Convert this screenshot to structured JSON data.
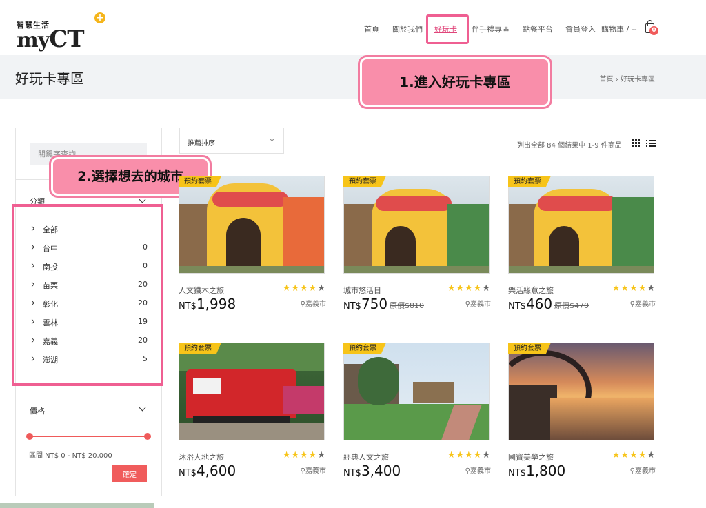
{
  "logo": {
    "small": "智慧生活",
    "brand": "my",
    "brand2": "CT",
    "plus": "+"
  },
  "nav": {
    "items": [
      "首頁",
      "關於我們",
      "好玩卡",
      "伴手禮專區",
      "點餐平台",
      "會員登入"
    ],
    "cart_label": "購物車 / --",
    "cart_count": "0"
  },
  "page": {
    "title": "好玩卡專區",
    "breadcrumb": "首頁 › 好玩卡專區"
  },
  "callouts": {
    "step1": "1.進入好玩卡專區",
    "step2": "2.選擇想去的城市"
  },
  "sidebar": {
    "search_placeholder": "關鍵字查詢",
    "category_title": "分類",
    "cities": [
      {
        "name": "全部",
        "count": ""
      },
      {
        "name": "台中",
        "count": "0"
      },
      {
        "name": "南投",
        "count": "0"
      },
      {
        "name": "苗栗",
        "count": "20"
      },
      {
        "name": "彰化",
        "count": "20"
      },
      {
        "name": "雲林",
        "count": "19"
      },
      {
        "name": "嘉義",
        "count": "20"
      },
      {
        "name": "澎湖",
        "count": "5"
      }
    ],
    "price_title": "價格",
    "price_range": "區間 NT$ 0 - NT$ 20,000",
    "confirm_label": "確定"
  },
  "toolbar": {
    "sort_label": "推薦排序",
    "result_text": "列出全部 84 個結果中 1-9 件商品"
  },
  "products": [
    {
      "tag": "預約套票",
      "name": "人文鐵木之旅",
      "currency": "NT$",
      "price": "1,998",
      "original": "",
      "location": "嘉義市",
      "stars": 4
    },
    {
      "tag": "預約套票",
      "name": "城市悠活日",
      "currency": "NT$",
      "price": "750",
      "original": "原價$810",
      "location": "嘉義市",
      "stars": 4
    },
    {
      "tag": "預約套票",
      "name": "樂活緣意之旅",
      "currency": "NT$",
      "price": "460",
      "original": "原價$470",
      "location": "嘉義市",
      "stars": 4
    },
    {
      "tag": "預約套票",
      "name": "沐浴大地之旅",
      "currency": "NT$",
      "price": "4,600",
      "original": "",
      "location": "嘉義市",
      "stars": 4
    },
    {
      "tag": "預約套票",
      "name": "經典人文之旅",
      "currency": "NT$",
      "price": "3,400",
      "original": "",
      "location": "嘉義市",
      "stars": 4
    },
    {
      "tag": "預約套票",
      "name": "國寶美學之旅",
      "currency": "NT$",
      "price": "1,800",
      "original": "",
      "location": "嘉義市",
      "stars": 4
    }
  ],
  "colors": {
    "accent": "#f05c5c",
    "highlight": "#ef5f92",
    "tag": "#f7c419",
    "star": "#f7c419"
  },
  "icons": [
    "cart-icon",
    "chevron-down-icon",
    "grid-view-icon",
    "list-view-icon",
    "location-pin-icon",
    "star-icon"
  ]
}
